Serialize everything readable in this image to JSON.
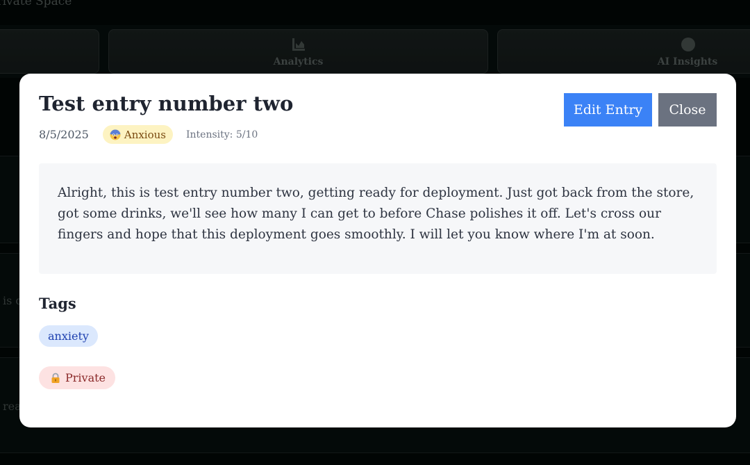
{
  "background": {
    "page_title": "Private Space",
    "tabs": [
      {
        "label": "",
        "icon": "journal-icon"
      },
      {
        "label": "Analytics",
        "icon": "chart-icon"
      },
      {
        "label": "AI Insights",
        "icon": "brain-icon"
      }
    ],
    "snippets": [
      "is d",
      "read"
    ]
  },
  "modal": {
    "title": "Test entry number two",
    "date": "8/5/2025",
    "mood": {
      "label": "Anxious",
      "icon": "anxious-face-icon"
    },
    "intensity": "Intensity: 5/10",
    "edit_label": "Edit Entry",
    "close_label": "Close",
    "content": "Alright, this is test entry number two, getting ready for deployment. Just got back from the store, got some drinks, we'll see how many I can get to before Chase polishes it off. Let's cross our fingers and hope that this deployment goes smoothly. I will let you know where I'm at soon.",
    "tags_heading": "Tags",
    "tags": [
      "anxiety"
    ],
    "privacy": {
      "label": "Private",
      "icon": "lock-icon"
    }
  },
  "colors": {
    "primary": "#3b82f6",
    "secondary": "#6b7280",
    "mood_badge_bg": "#fdf3c2",
    "tag_bg": "#dbe8fd",
    "private_bg": "#fde2e2"
  }
}
